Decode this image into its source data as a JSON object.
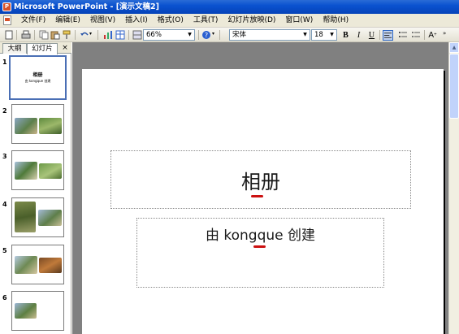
{
  "window": {
    "title": "Microsoft PowerPoint - [演示文稿2]"
  },
  "menu": {
    "items": [
      "文件(F)",
      "编辑(E)",
      "视图(V)",
      "插入(I)",
      "格式(O)",
      "工具(T)",
      "幻灯片放映(D)",
      "窗口(W)",
      "帮助(H)"
    ]
  },
  "toolbar": {
    "zoom": "66%",
    "font_name": "宋体",
    "font_size": "18",
    "bold": "B",
    "italic": "I",
    "underline": "U",
    "font_grow": "A"
  },
  "pane": {
    "tabs": [
      "大纲",
      "幻灯片"
    ],
    "close": "×",
    "slides": [
      {
        "number": "1",
        "title": "相册",
        "subtitle": "由 kongque 创建",
        "selected": true
      },
      {
        "number": "2"
      },
      {
        "number": "3"
      },
      {
        "number": "4"
      },
      {
        "number": "5"
      },
      {
        "number": "6"
      }
    ]
  },
  "slide": {
    "title": "相册",
    "subtitle": "由 kongque 创建"
  },
  "colors": {
    "titlebar": "#0a52d0",
    "chrome": "#ece9d8",
    "workspace": "#808080",
    "spell_error": "#cc1111"
  }
}
